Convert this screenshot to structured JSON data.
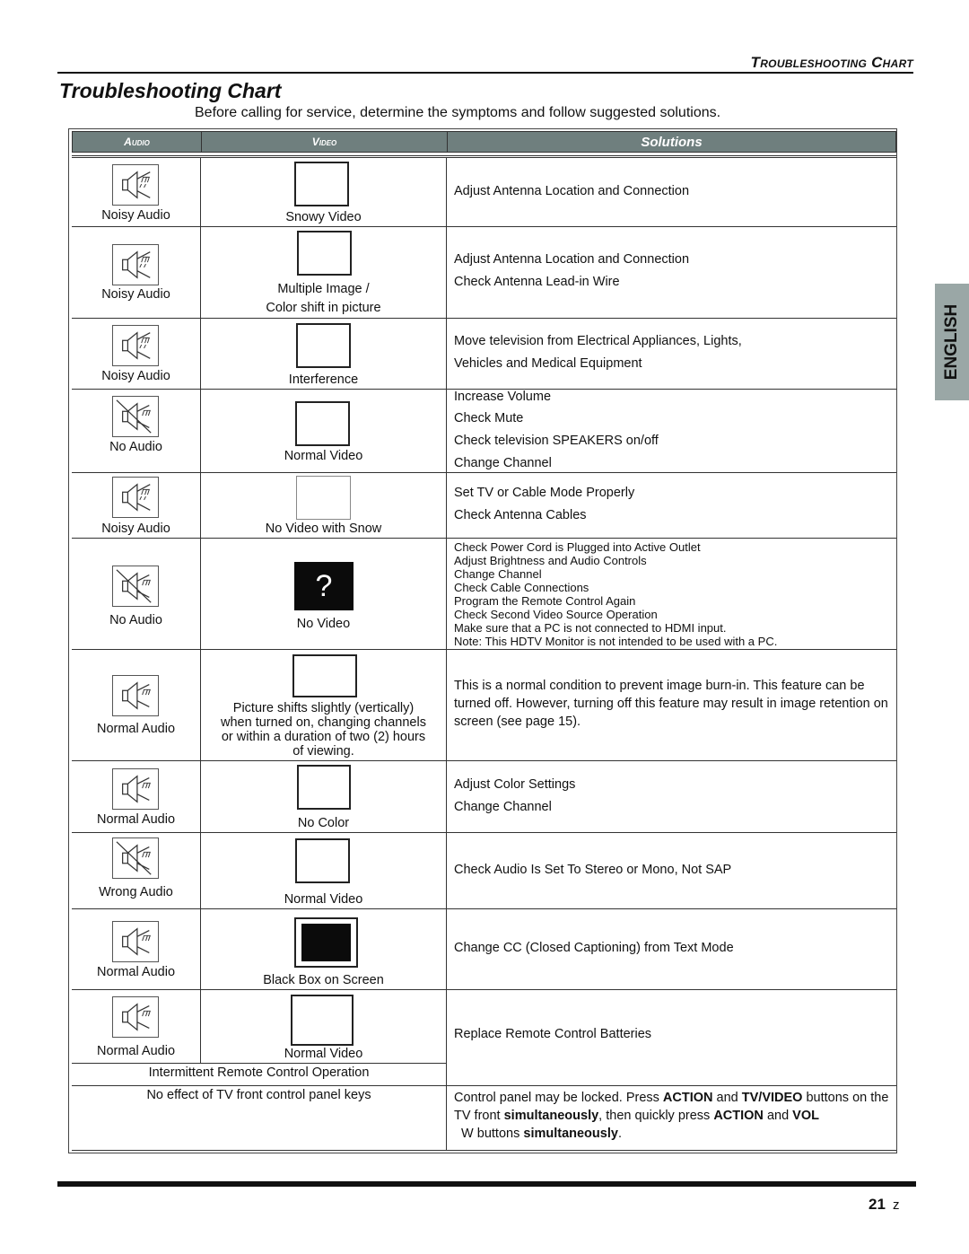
{
  "header": {
    "running_head": "Troubleshooting Chart",
    "title": "Troubleshooting Chart",
    "intro": "Before calling for service, determine the symptoms and follow suggested solutions."
  },
  "columns": {
    "audio": "Audio",
    "video": "Video",
    "solutions": "Solutions"
  },
  "rows": [
    {
      "audio": "Noisy Audio",
      "audio_icon": "noisy-speaker-icon",
      "video": "Snowy Video",
      "video_icon": "blank-screen-icon",
      "solutions": [
        "Adjust Antenna Location and Connection"
      ]
    },
    {
      "audio": "Noisy Audio",
      "audio_icon": "noisy-speaker-icon",
      "video": "Multiple Image /",
      "video2": "Color shift in picture",
      "video_icon": "blank-screen-icon",
      "solutions": [
        "Adjust Antenna Location and Connection",
        "Check Antenna Lead-in Wire"
      ]
    },
    {
      "audio": "Noisy Audio",
      "audio_icon": "noisy-speaker-icon",
      "video": "Interference",
      "video_icon": "blank-screen-icon",
      "solutions": [
        "Move television from Electrical Appliances, Lights,",
        "Vehicles and Medical Equipment"
      ]
    },
    {
      "audio": "No Audio",
      "audio_icon": "muted-speaker-icon",
      "video": "Normal Video",
      "video_icon": "blank-screen-icon",
      "solutions": [
        "Increase Volume",
        "Check Mute",
        "Check television SPEAKERS on/off",
        "Change Channel"
      ]
    },
    {
      "audio": "Noisy Audio",
      "audio_icon": "noisy-speaker-icon",
      "video": "No Video with Snow",
      "video_icon": "blank-screen-icon",
      "solutions": [
        "Set TV or Cable Mode Properly",
        "Check Antenna Cables"
      ]
    },
    {
      "audio": "No Audio",
      "audio_icon": "muted-speaker-icon",
      "video": "No Video",
      "video_icon": "question-screen-icon",
      "video_glyph": "?",
      "solutions": [
        "Check Power Cord is Plugged into Active Outlet",
        "Adjust Brightness and Audio Controls",
        "Change Channel",
        "Check Cable Connections",
        "Program the Remote Control Again",
        "Check Second Video Source Operation",
        "Make sure that a PC is not connected to HDMI input.",
        "Note: This HDTV Monitor is not intended to be used with a PC."
      ]
    },
    {
      "audio": "Normal Audio",
      "audio_icon": "speaker-icon",
      "video_lines": [
        "Picture shifts slightly (vertically)",
        "when turned on, changing channels",
        "or within a duration of two (2) hours",
        "of viewing."
      ],
      "video_icon": "blank-screen-icon",
      "solutions": [
        "This is a normal condition to prevent image burn-in. This feature can be turned off. However, turning off this feature may result in image retention on screen (see page 15)."
      ]
    },
    {
      "audio": "Normal Audio",
      "audio_icon": "speaker-icon",
      "video": "No Color",
      "video_icon": "blank-screen-icon",
      "solutions": [
        "Adjust Color Settings",
        "Change Channel"
      ]
    },
    {
      "audio": "Wrong Audio",
      "audio_icon": "muted-speaker-icon",
      "video": "Normal Video",
      "video_icon": "blank-screen-icon",
      "solutions": [
        "Check Audio Is Set To Stereo or Mono, Not SAP"
      ]
    },
    {
      "audio": "Normal Audio",
      "audio_icon": "speaker-icon",
      "video": "Black Box on Screen",
      "video_icon": "black-box-screen-icon",
      "solutions": [
        "Change CC (Closed Captioning) from Text Mode"
      ]
    },
    {
      "audio": "Normal Audio",
      "audio_icon": "speaker-icon",
      "video": "Normal Video",
      "video_icon": "blank-screen-icon",
      "symptom": "Intermittent Remote Control Operation",
      "solutions": [
        "Replace Remote Control Batteries"
      ]
    },
    {
      "symptom": "No effect of TV front control panel keys",
      "solution_parts": {
        "p1": "Control panel may be locked. Press ",
        "b1": "ACTION",
        "p2": " and ",
        "b2": "TV/VIDEO",
        "p3": " buttons on the TV front ",
        "b3": "simultaneously",
        "p4": ", then quickly press ",
        "b4": "ACTION",
        "p5": " and ",
        "b5": "VOL",
        "p6": "  W buttons ",
        "b6": "simultaneously",
        "p7": "."
      }
    }
  ],
  "side_tab": "ENGLISH",
  "footer": {
    "page_number": "21",
    "suffix": "z"
  },
  "colors": {
    "header_fill": "#6f7f7e",
    "side_tab_fill": "#9aa7a6"
  }
}
